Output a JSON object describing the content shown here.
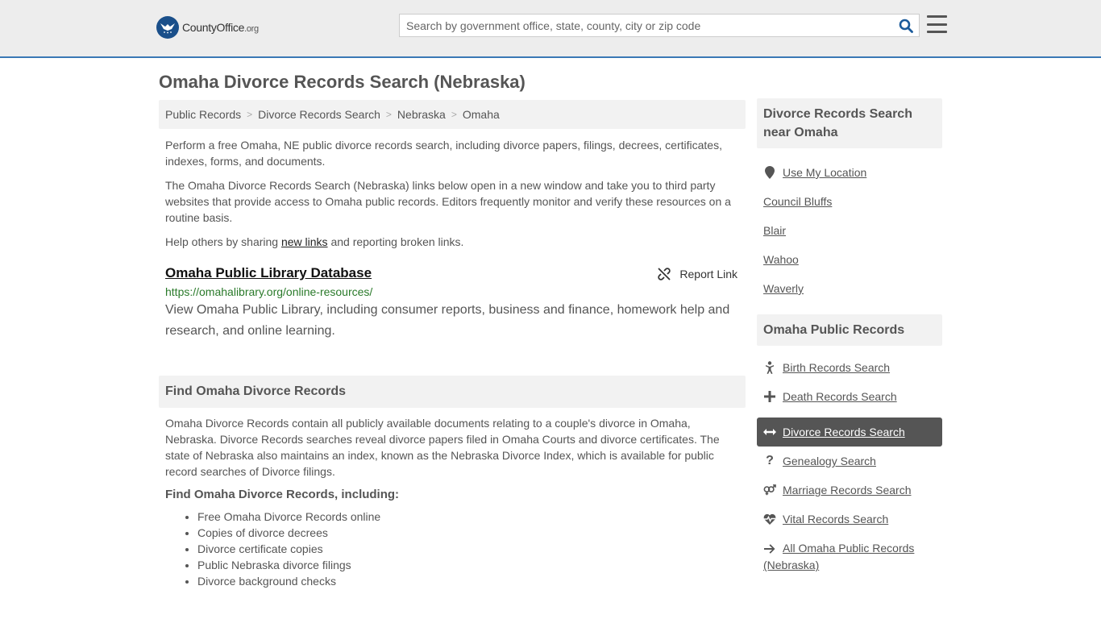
{
  "header": {
    "logo_main": "CountyOffice",
    "logo_org": ".org",
    "search_placeholder": "Search by government office, state, county, city or zip code"
  },
  "page": {
    "title": "Omaha Divorce Records Search (Nebraska)"
  },
  "breadcrumb": [
    {
      "label": "Public Records"
    },
    {
      "label": "Divorce Records Search"
    },
    {
      "label": "Nebraska"
    },
    {
      "label": "Omaha"
    }
  ],
  "intro": {
    "p1": "Perform a free Omaha, NE public divorce records search, including divorce papers, filings, decrees, certificates, indexes, forms, and documents.",
    "p2": "The Omaha Divorce Records Search (Nebraska) links below open in a new window and take you to third party websites that provide access to Omaha public records. Editors frequently monitor and verify these resources on a routine basis.",
    "p3_before": "Help others by sharing ",
    "p3_link": "new links",
    "p3_after": " and reporting broken links."
  },
  "result": {
    "title": "Omaha Public Library Database",
    "report_label": "Report Link",
    "url": "https://omahalibrary.org/online-resources/",
    "description": "View Omaha Public Library, including consumer reports, business and finance, homework help and research, and online learning."
  },
  "find_section": {
    "heading": "Find Omaha Divorce Records",
    "body": "Omaha Divorce Records contain all publicly available documents relating to a couple's divorce in Omaha, Nebraska. Divorce Records searches reveal divorce papers filed in Omaha Courts and divorce certificates. The state of Nebraska also maintains an index, known as the Nebraska Divorce Index, which is available for public record searches of Divorce filings.",
    "subheading": "Find Omaha Divorce Records, including:",
    "items": [
      "Free Omaha Divorce Records online",
      "Copies of divorce decrees",
      "Divorce certificate copies",
      "Public Nebraska divorce filings",
      "Divorce background checks"
    ]
  },
  "sidebar": {
    "nearby_heading": "Divorce Records Search near Omaha",
    "use_location": "Use My Location",
    "nearby": [
      "Council Bluffs",
      "Blair",
      "Wahoo",
      "Waverly"
    ],
    "records_heading": "Omaha Public Records",
    "records": [
      {
        "label": "Birth Records Search",
        "icon": "baby-icon"
      },
      {
        "label": "Death Records Search",
        "icon": "cross-icon"
      },
      {
        "label": "Divorce Records Search",
        "icon": "arrows-horizontal-icon",
        "active": true
      },
      {
        "label": "Genealogy Search",
        "icon": "question-icon"
      },
      {
        "label": "Marriage Records Search",
        "icon": "gender-symbols-icon"
      },
      {
        "label": "Vital Records Search",
        "icon": "heartbeat-icon"
      },
      {
        "label": "All Omaha Public Records (Nebraska)",
        "icon": "arrow-right-icon"
      }
    ]
  }
}
